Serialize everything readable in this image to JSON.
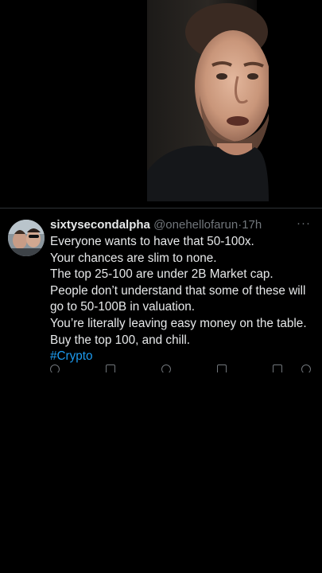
{
  "tweet": {
    "display_name": "sixtysecondalpha",
    "handle": "@onehellofarun",
    "separator": "·",
    "timestamp": "17h",
    "more_icon": "more-horizontal-icon",
    "lines": [
      "Everyone wants to have that 50-100x.",
      "Your chances are slim to none.",
      "The top 25-100 are under 2B Market cap.",
      "People don’t understand that some of these will",
      "go to 50-100B in valuation.",
      "You’re literally leaving easy money on the table.",
      "Buy the top 100, and chill."
    ],
    "hashtag": "#Crypto"
  },
  "theme": {
    "background": "#000000",
    "text": "#e7e9ea",
    "muted": "#71767b",
    "link": "#1d9bf0",
    "divider": "#2f3336"
  },
  "actions": [
    "reply-icon",
    "retweet-icon",
    "like-icon",
    "views-icon",
    "bookmark-icon",
    "share-icon"
  ]
}
